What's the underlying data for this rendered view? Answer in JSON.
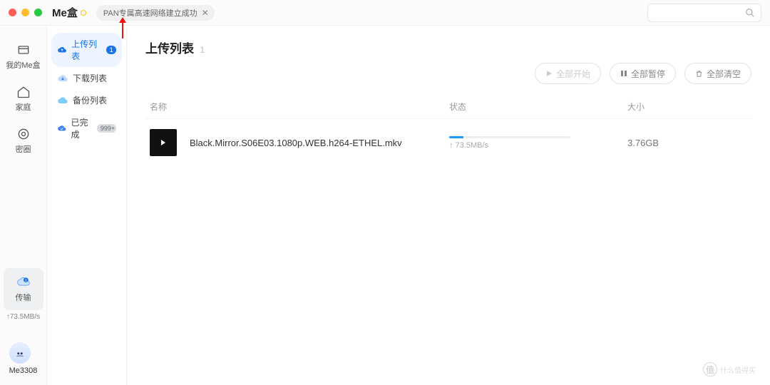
{
  "app_name": "Me盒",
  "traffic_colors": [
    "#ff5f57",
    "#febc2e",
    "#28c840"
  ],
  "tab": {
    "label": "PAN专属高速网络建立成功"
  },
  "nav": {
    "items": [
      {
        "icon": "box",
        "label": "我的Me盒"
      },
      {
        "icon": "home",
        "label": "家庭"
      },
      {
        "icon": "circle",
        "label": "密圈"
      }
    ],
    "transfer": {
      "label": "传输",
      "speed": "↑73.5MB/s"
    },
    "user": "Me3308"
  },
  "sub": {
    "items": [
      {
        "icon": "up",
        "label": "上传列表",
        "badge": "1",
        "active": true
      },
      {
        "icon": "down",
        "label": "下载列表"
      },
      {
        "icon": "backup",
        "label": "备份列表"
      },
      {
        "icon": "done",
        "label": "已完成",
        "badge": "999+",
        "grey": true
      }
    ]
  },
  "content": {
    "title": "上传列表",
    "count": "1",
    "actions": {
      "start": "全部开始",
      "pause": "全部暂停",
      "clear": "全部清空"
    },
    "headers": {
      "name": "名称",
      "status": "状态",
      "size": "大小"
    },
    "rows": [
      {
        "name": "Black.Mirror.S06E03.1080p.WEB.h264-ETHEL.mkv",
        "speed": "↑ 73.5MB/s",
        "size": "3.76GB"
      }
    ]
  },
  "watermark": "什么值得买"
}
